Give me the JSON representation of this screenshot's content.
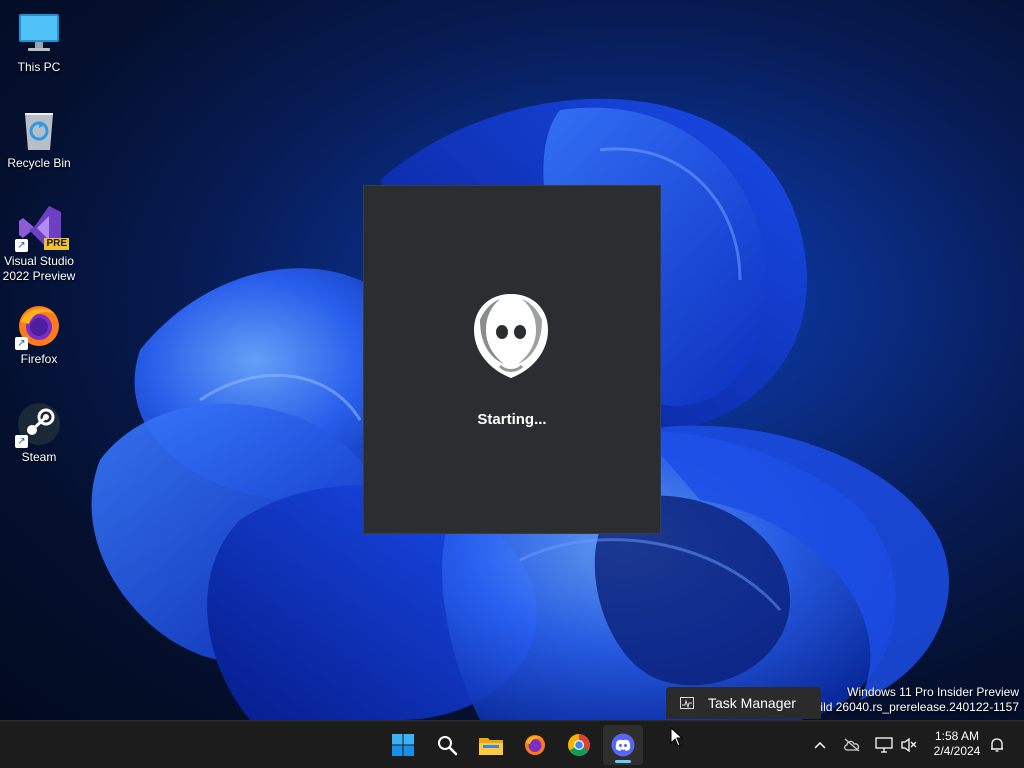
{
  "desktop_icons": [
    {
      "label": "This PC",
      "icon": "monitor-icon"
    },
    {
      "label": "Recycle Bin",
      "icon": "recycle-bin-icon"
    },
    {
      "label": "Visual Studio\n2022 Preview",
      "line1": "Visual Studio",
      "line2": "2022 Preview",
      "badge": "PRE",
      "icon": "visual-studio-icon"
    },
    {
      "label": "Firefox",
      "icon": "firefox-icon"
    },
    {
      "label": "Steam",
      "icon": "steam-icon"
    }
  ],
  "splash": {
    "status": "Starting...",
    "icon": "discord-logo-icon"
  },
  "watermark": {
    "line1": "Windows 11 Pro Insider Preview",
    "line2": "Build 26040.rs_prerelease.240122-1157"
  },
  "tooltip": {
    "label": "Task Manager",
    "icon": "task-manager-icon"
  },
  "taskbar": {
    "apps": [
      "start-icon",
      "search-icon",
      "file-explorer-icon",
      "firefox-icon",
      "chrome-icon",
      "discord-icon"
    ],
    "active_app": "discord-icon"
  },
  "tray": {
    "time": "1:58 AM",
    "date": "2/4/2024",
    "icons": [
      "chevron-up-icon",
      "cloud-offline-icon",
      "network-icon",
      "volume-muted-icon",
      "notification-bell-icon"
    ]
  },
  "colors": {
    "accent": "#60cdff",
    "splash_bg": "#2b2d31",
    "taskbar_bg": "#1c1c1c",
    "discord_blurple": "#5865f2"
  }
}
